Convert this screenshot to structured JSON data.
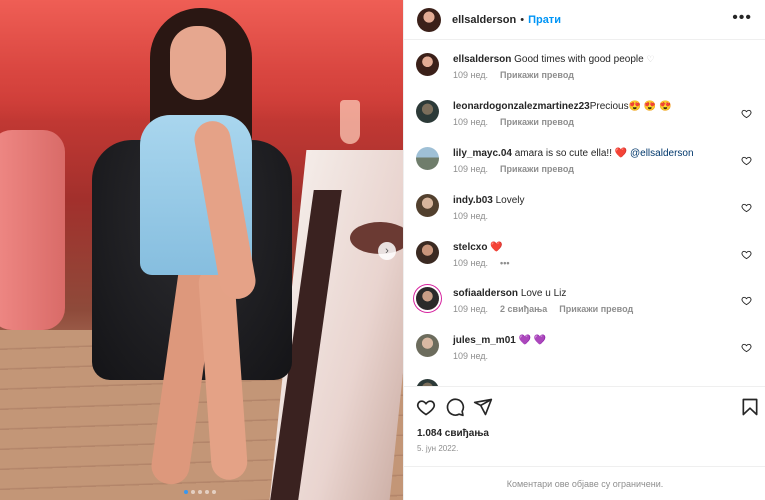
{
  "post": {
    "username": "ellsalderson",
    "separator": "•",
    "follow_label": "Прати",
    "more_label": "•••"
  },
  "photo": {
    "next_label": "›",
    "slide_count": 5,
    "active_slide": 1
  },
  "caption": {
    "username": "ellsalderson",
    "text": "Good times with good people",
    "emoji": "♡",
    "age": "109 нед.",
    "translate": "Прикажи превод"
  },
  "comments": [
    {
      "username": "leonardogonzalezmartinez23",
      "text": "Precious😍 😍 😍",
      "age": "109 нед.",
      "translate": "Прикажи превод",
      "likes": "",
      "extra": ""
    },
    {
      "username": "lily_mayc.04",
      "text": "amara is so cute ella!! ❤️",
      "mention": "@ellsalderson",
      "age": "109 нед.",
      "translate": "Прикажи превод",
      "likes": "",
      "extra": ""
    },
    {
      "username": "indy.b03",
      "text": "Lovely",
      "age": "109 нед.",
      "translate": "",
      "likes": "",
      "extra": ""
    },
    {
      "username": "stelcxo",
      "text": "❤️",
      "age": "109 нед.",
      "translate": "",
      "likes": "",
      "extra": "•••"
    },
    {
      "username": "sofiaalderson",
      "text": "Love u Liz",
      "age": "109 нед.",
      "translate": "Прикажи превод",
      "likes": "2 свиђања",
      "extra": ""
    },
    {
      "username": "jules_m_m01",
      "text": "💜 💜",
      "age": "109 нед.",
      "translate": "",
      "likes": "",
      "extra": ""
    }
  ],
  "footer": {
    "likes": "1.084 свиђања",
    "date": "5. јун 2022.",
    "comments_limited": "Коментари ове објаве су ограничени."
  },
  "colors": {
    "accent": "#0095f6",
    "text": "#262626",
    "muted": "#8e8e8e",
    "border": "#efefef"
  }
}
